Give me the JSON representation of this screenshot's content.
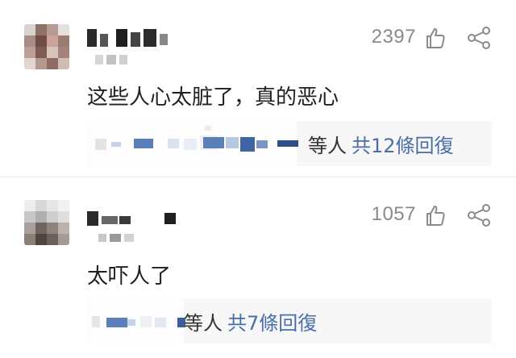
{
  "comments": [
    {
      "text": "这些人心太脏了，真的恶心",
      "likes": "2397",
      "reply_people": "等人",
      "reply_count_text": "共12條回復"
    },
    {
      "text": "太吓人了",
      "likes": "1057",
      "reply_people": "等人",
      "reply_count_text": "共7條回復"
    }
  ],
  "icons": {
    "like": "thumbs-up-icon",
    "share": "share-icon"
  },
  "colors": {
    "text": "#1f1f1f",
    "muted": "#8a8a8a",
    "link": "#4a6ea9",
    "reply_bg": "#f7f7f7"
  }
}
